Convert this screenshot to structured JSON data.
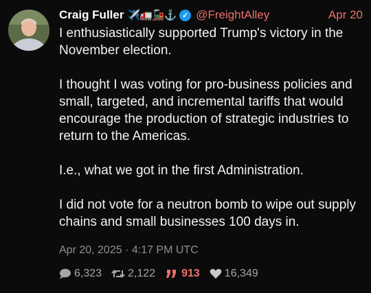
{
  "author": {
    "name": "Craig Fuller",
    "emoji": "✈️🚛🚂⚓",
    "handle": "@FreightAlley"
  },
  "post": {
    "date_short": "Apr 20",
    "paragraphs": [
      "I enthusiastically supported Trump's victory in the November election.",
      "I thought I was voting for pro-business policies and small, targeted, and incremental tariffs that would encourage the production of strategic industries to return to the Americas.",
      "I.e., what we got in the first Administration.",
      "I did not vote for a neutron bomb to wipe out supply chains and small businesses 100 days in."
    ],
    "timestamp": "Apr 20, 2025 · 4:17 PM UTC"
  },
  "stats": {
    "replies": "6,323",
    "reposts": "2,122",
    "quotes": "913",
    "likes": "16,349"
  },
  "colors": {
    "accent": "#ef6f6a",
    "verified": "#1d9bf0",
    "background": "#0b0b0b"
  }
}
